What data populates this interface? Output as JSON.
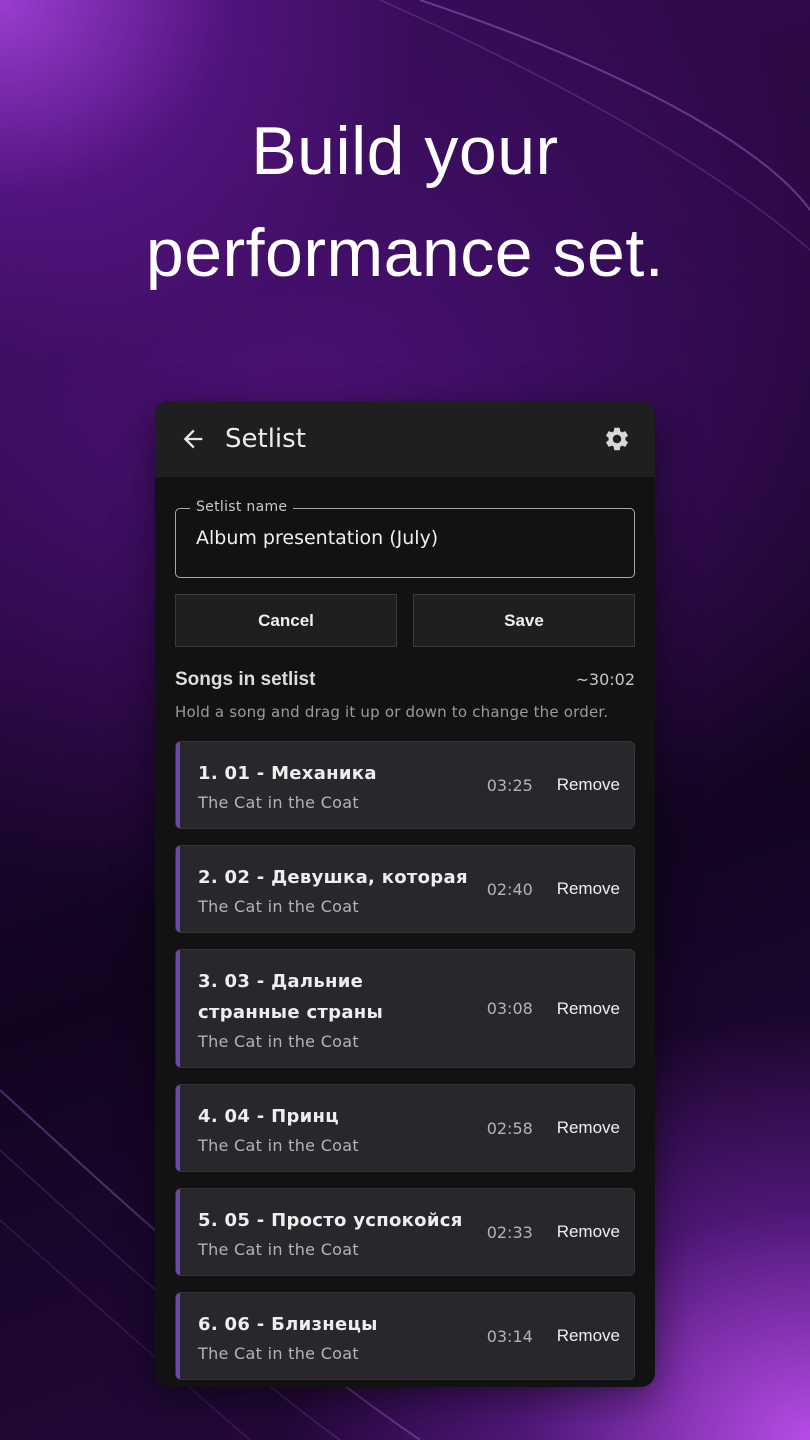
{
  "headline": {
    "line1": "Build your",
    "line2": "performance set."
  },
  "appbar": {
    "title": "Setlist",
    "back_icon": "arrow-back-icon",
    "settings_icon": "gear-icon"
  },
  "form": {
    "field_label": "Setlist name",
    "field_value": "Album presentation (July)"
  },
  "buttons": {
    "cancel": "Cancel",
    "save": "Save"
  },
  "section": {
    "title": "Songs in setlist",
    "total": "~30:02",
    "hint": "Hold a song and drag it up or down to change the order."
  },
  "songs": [
    {
      "title": "1. 01 - Механика",
      "artist": "The Cat in the Coat",
      "duration": "03:25",
      "action": "Remove"
    },
    {
      "title": "2. 02 - Девушка, которая",
      "artist": "The Cat in the Coat",
      "duration": "02:40",
      "action": "Remove"
    },
    {
      "title": "3. 03 - Дальние странные страны",
      "artist": "The Cat in the Coat",
      "duration": "03:08",
      "action": "Remove"
    },
    {
      "title": "4. 04 - Принц",
      "artist": "The Cat in the Coat",
      "duration": "02:58",
      "action": "Remove"
    },
    {
      "title": "5. 05 - Просто успокойся",
      "artist": "The Cat in the Coat",
      "duration": "02:33",
      "action": "Remove"
    },
    {
      "title": "6. 06 - Близнецы",
      "artist": "The Cat in the Coat",
      "duration": "03:14",
      "action": "Remove"
    }
  ],
  "colors": {
    "accent": "#6a4aa8",
    "card": "#28282c",
    "background": "#121212"
  }
}
